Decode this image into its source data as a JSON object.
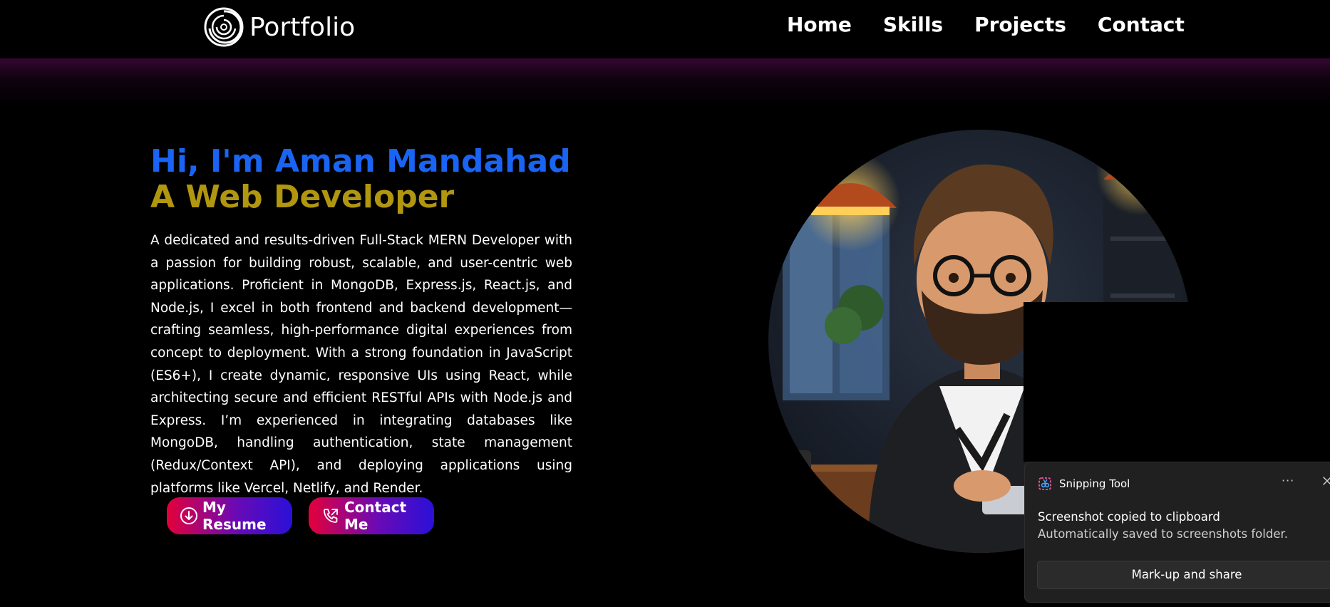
{
  "header": {
    "brand_name": "Portfolio",
    "nav": [
      {
        "label": "Home"
      },
      {
        "label": "Skills"
      },
      {
        "label": "Projects"
      },
      {
        "label": "Contact"
      }
    ]
  },
  "hero": {
    "greeting": "Hi, I'm Aman Mandahad",
    "role": "A Web Developer",
    "bio": "A dedicated and results-driven Full-Stack MERN Developer with a passion for building robust, scalable, and user-centric web applications. Proficient in MongoDB, Express.js, React.js, and Node.js, I excel in both frontend and backend development—crafting seamless, high-performance digital experiences from concept to deployment. With a strong foundation in JavaScript (ES6+), I create dynamic, responsive UIs using React, while architecting secure and efficient RESTful APIs with Node.js and Express. I’m experienced in integrating databases like MongoDB, handling authentication, state management (Redux/Context API), and deploying applications using platforms like Vercel, Netlify, and Render.",
    "buttons": {
      "resume_label": "My Resume",
      "contact_label": "Contact Me"
    }
  },
  "notification": {
    "app_name": "Snipping Tool",
    "more_label": "···",
    "title": "Screenshot copied to clipboard",
    "body": "Automatically saved to screenshots folder.",
    "action_label": "Mark-up and share"
  },
  "colors": {
    "accent_blue": "#1a64f3",
    "accent_gold": "#b1960f",
    "button_gradient_start": "#e4003a",
    "button_gradient_end": "#2a10d8"
  },
  "icons": {
    "brand": "spiral-logo-icon",
    "resume_button": "download-circle-icon",
    "contact_button": "phone-call-icon",
    "notification_app": "snipping-tool-icon",
    "notification_close": "close-icon"
  }
}
